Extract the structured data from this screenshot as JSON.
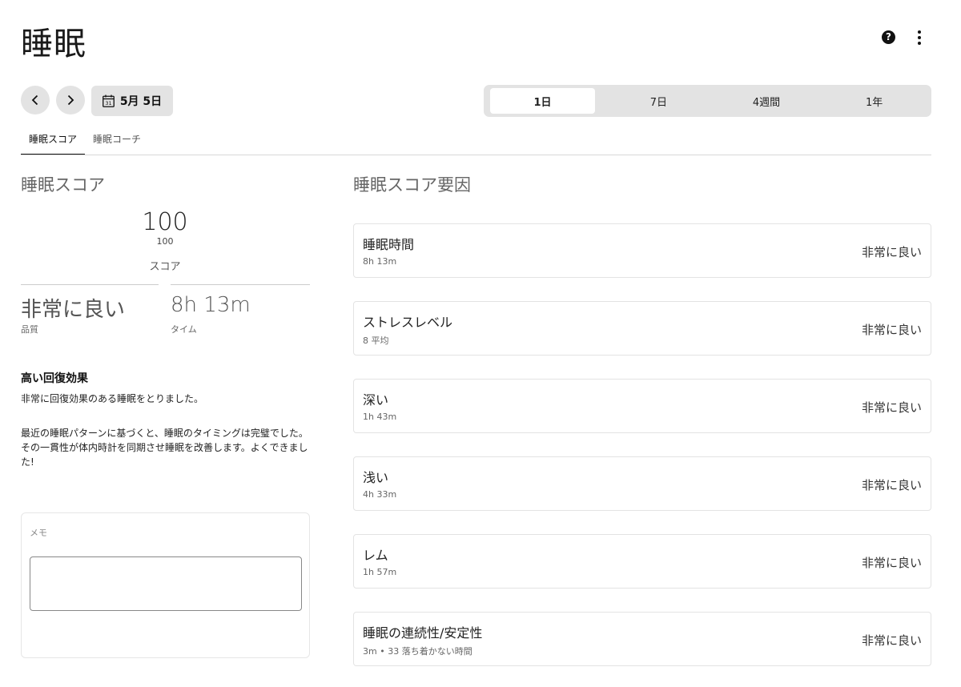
{
  "header": {
    "title": "睡眠"
  },
  "date_nav": {
    "date_label": "5月 5日",
    "calendar_day": "31"
  },
  "range_tabs": [
    {
      "label": "1日",
      "active": true
    },
    {
      "label": "7日",
      "active": false
    },
    {
      "label": "4週間",
      "active": false
    },
    {
      "label": "1年",
      "active": false
    }
  ],
  "sub_tabs": [
    {
      "label": "睡眠スコア",
      "active": true
    },
    {
      "label": "睡眠コーチ",
      "active": false
    }
  ],
  "score_section": {
    "title": "睡眠スコア",
    "score": "100",
    "score_max": "100",
    "score_label": "スコア",
    "quality_value": "非常に良い",
    "quality_label": "品質",
    "time_value": "8h 13m",
    "time_label": "タイム"
  },
  "restoration": {
    "title": "高い回復効果",
    "line1": "非常に回復効果のある睡眠をとりました。",
    "line2": "最近の睡眠パターンに基づくと、睡眠のタイミングは完璧でした。その一貫性が体内時計を同期させ睡眠を改善します。よくできました!"
  },
  "memo": {
    "label": "メモ",
    "value": ""
  },
  "factors_section": {
    "title": "睡眠スコア要因",
    "items": [
      {
        "name": "睡眠時間",
        "sub": "8h 13m",
        "rating": "非常に良い"
      },
      {
        "name": "ストレスレベル",
        "sub": "8 平均",
        "rating": "非常に良い"
      },
      {
        "name": "深い",
        "sub": "1h 43m",
        "rating": "非常に良い"
      },
      {
        "name": "浅い",
        "sub": "4h 33m",
        "rating": "非常に良い"
      },
      {
        "name": "レム",
        "sub": "1h 57m",
        "rating": "非常に良い"
      },
      {
        "name": "睡眠の連続性/安定性",
        "sub": "3m • 33 落ち着かない時間",
        "rating": "非常に良い"
      }
    ]
  }
}
